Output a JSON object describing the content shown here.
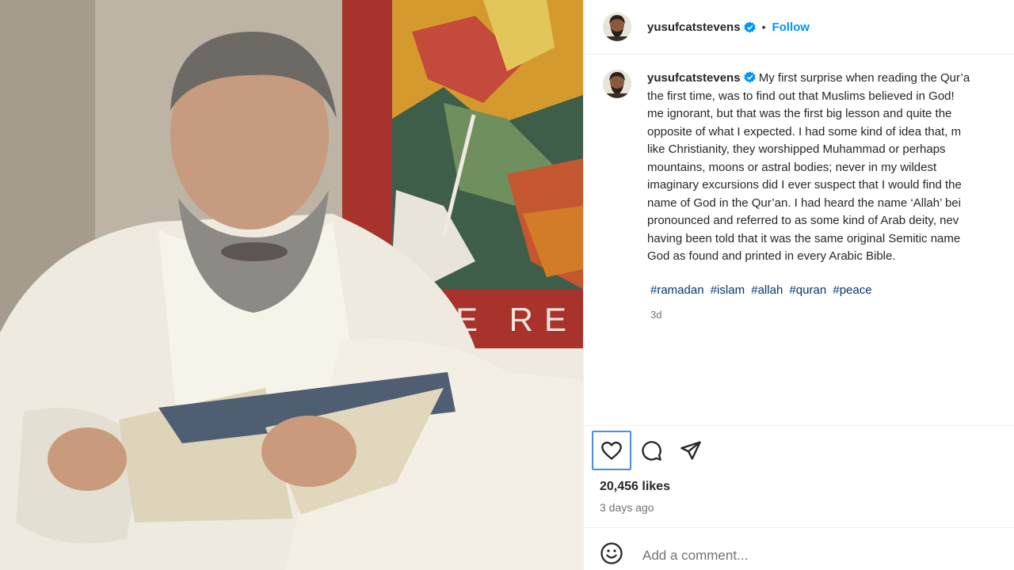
{
  "post": {
    "username": "yusufcatstevens",
    "follow_label": "Follow",
    "separator": "•",
    "caption_lines": [
      "My first surprise when reading the Qur’a",
      "the first time, was to find out that Muslims believed in God!",
      "me ignorant, but that was the first big lesson and quite the",
      "opposite of what I expected. I had some kind of idea that, m",
      "like Christianity, they worshipped Muhammad or perhaps",
      "mountains, moons or astral bodies; never in my wildest",
      "imaginary excursions did I ever suspect that I would find the",
      "name of God in the Qur’an. I had heard the name ‘Allah’ bei",
      "pronounced and referred to as some kind of Arab deity, nev",
      "having been told that it was the same original Semitic name",
      "God as found and printed in every Arabic Bible."
    ],
    "hashtags": [
      "#ramadan",
      "#islam",
      "#allah",
      "#quran",
      "#peace"
    ],
    "caption_age": "3d",
    "likes": "20,456 likes",
    "posted": "3 days ago",
    "comment_placeholder": "Add a comment...",
    "photo_sign_text": "E RE"
  },
  "colors": {
    "accent": "#0095f6",
    "hashtag": "#00376b",
    "verified": "#0095f6",
    "muted": "#737373"
  },
  "icons": {
    "like": "heart-icon",
    "comment": "comment-icon",
    "share": "paper-plane-icon",
    "emoji": "smiley-icon",
    "verified": "verified-badge-icon"
  }
}
